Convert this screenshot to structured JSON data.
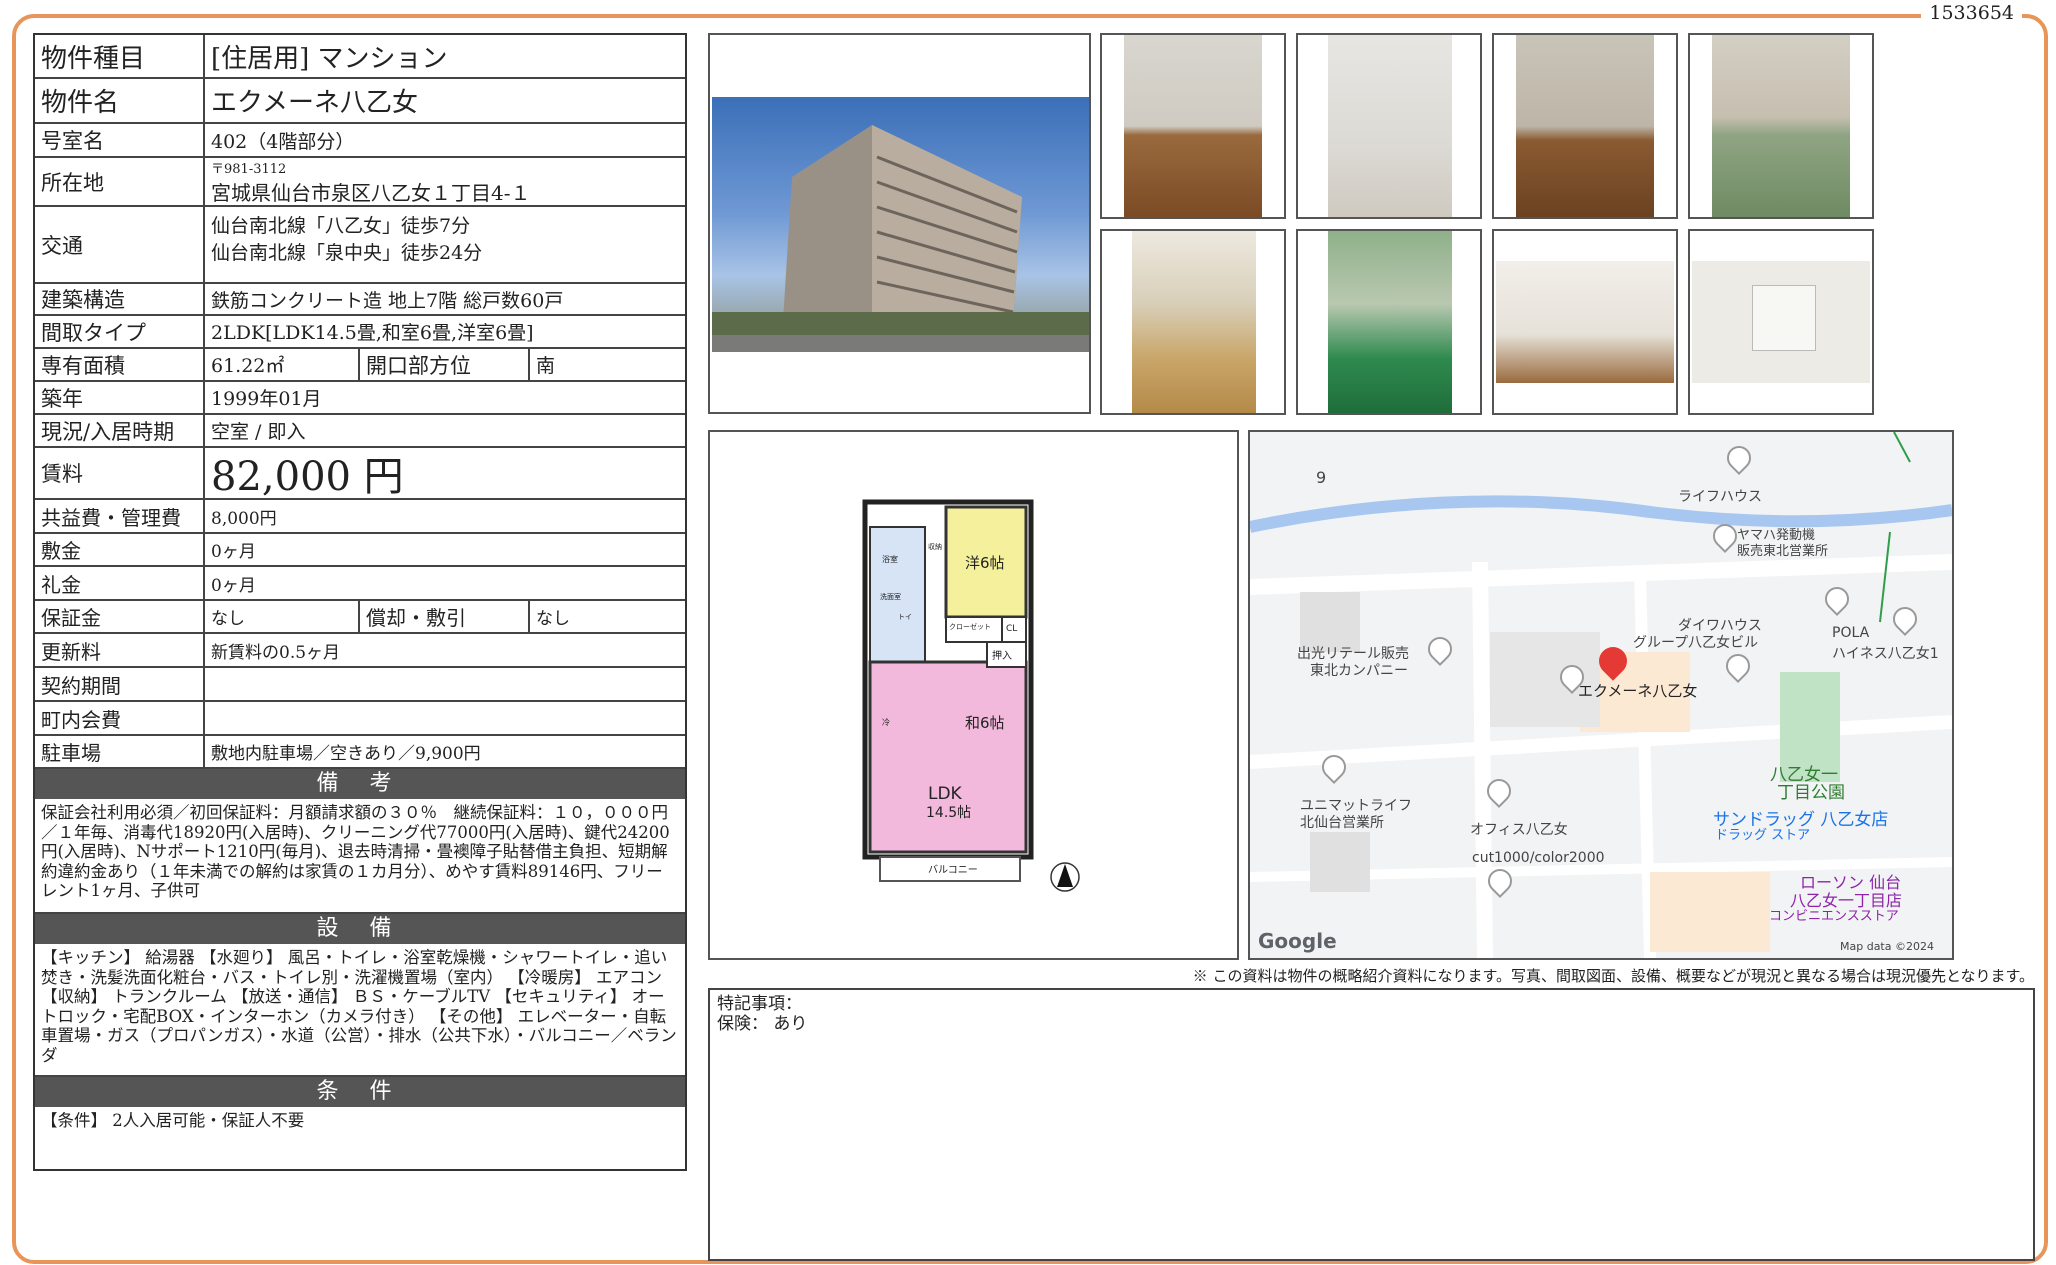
{
  "doc_id": "1533654",
  "property": {
    "type_label": "物件種目",
    "type_value": "[住居用]  マンション",
    "name_label": "物件名",
    "name_value": "エクメーネ八乙女",
    "room_label": "号室名",
    "room_value": "402（4階部分）",
    "address_label": "所在地",
    "postal": "〒981-3112",
    "address": "宮城県仙台市泉区八乙女１丁目4-１",
    "transit_label": "交通",
    "transit_1": "仙台南北線「八乙女」徒歩7分",
    "transit_2": "仙台南北線「泉中央」徒歩24分",
    "structure_label": "建築構造",
    "structure_value": "鉄筋コンクリート造 地上7階 総戸数60戸",
    "layout_label": "間取タイプ",
    "layout_value": "2LDK[LDK14.5畳,和室6畳,洋室6畳]",
    "area_label": "専有面積",
    "area_value": "61.22㎡",
    "direction_label": "開口部方位",
    "direction_value": "南",
    "built_label": "築年",
    "built_value": "1999年01月",
    "status_label": "現況/入居時期",
    "status_value": "空室 / 即入",
    "rent_label": "賃料",
    "rent_value": "82,000 円",
    "fee_label": "共益費・管理費",
    "fee_value": "8,000円",
    "deposit_label": "敷金",
    "deposit_value": "0ヶ月",
    "keymoney_label": "礼金",
    "keymoney_value": "0ヶ月",
    "guarantee_label": "保証金",
    "guarantee_value": "なし",
    "amort_label": "償却・敷引",
    "amort_value": "なし",
    "renewal_label": "更新料",
    "renewal_value": "新賃料の0.5ヶ月",
    "contract_label": "契約期間",
    "contract_value": "",
    "community_label": "町内会費",
    "community_value": "",
    "parking_label": "駐車場",
    "parking_value": "敷地内駐車場／空きあり／9,900円"
  },
  "remarks": {
    "title": "備 考",
    "text": "保証会社利用必須／初回保証料：月額請求額の３０％　継続保証料：１０，０００円／１年毎、消毒代18920円(入居時)、クリーニング代77000円(入居時)、鍵代24200円(入居時)、Nサポート1210円(毎月)、退去時清掃・畳襖障子貼替借主負担、短期解約違約金あり（１年未満での解約は家賃の１カ月分）、めやす賃料89146円、フリーレント1ヶ月、子供可"
  },
  "equipment": {
    "title": "設 備",
    "text": "【キッチン】 給湯器 【水廻り】 風呂・トイレ・浴室乾燥機・シャワートイレ・追い焚き・洗髪洗面化粧台・バス・トイレ別・洗濯機置場（室内） 【冷暖房】 エアコン 【収納】 トランクルーム 【放送・通信】 ＢＳ・ケーブルTV 【セキュリティ】 オートロック・宅配BOX・インターホン（カメラ付き） 【その他】 エレベーター・自転車置場・ガス（プロパンガス）・水道（公営）・排水（公共下水）・バルコニー／ベランダ"
  },
  "conditions": {
    "title": "条 件",
    "text": "【条件】 2人入居可能・保証人不要"
  },
  "floorplan": {
    "room_western": "洋6帖",
    "room_japanese": "和6帖",
    "ldk": "LDK",
    "ldk_size": "14.5帖",
    "balcony": "バルコニー",
    "closet": "クローゼット",
    "cl": "CL",
    "oshiire": "押入",
    "bath": "浴室",
    "washroom": "洗面室",
    "storage": "収納",
    "fridge": "冷",
    "toilet": "トイ"
  },
  "map": {
    "labels": [
      "9",
      "ライフハウス",
      "ヤマハ発動機",
      "販売東北営業所",
      "ダイワハウス",
      "グループ八乙女ビル",
      "POLA",
      "ハイネス八乙女1",
      "出光リテール販売",
      "東北カンパニー",
      "エクメーネ八乙女",
      "八乙女一",
      "丁目公園",
      "ユニマットライフ",
      "北仙台営業所",
      "オフィス八乙女",
      "サンドラッグ 八乙女店",
      "ドラッグ ストア",
      "cut1000/color2000",
      "ローソン 仙台",
      "八乙女一丁目店",
      "コンビニエンスストア"
    ],
    "google": "Google",
    "attribution": "Map data ©2024",
    "accent_color": "#e53935"
  },
  "disclaimer": "※ この資料は物件の概略紹介資料になります。写真、間取図面、設備、概要などが現況と異なる場合は現況優先となります。",
  "special": {
    "line1": "特記事項：",
    "line2": "保険：  あり"
  }
}
